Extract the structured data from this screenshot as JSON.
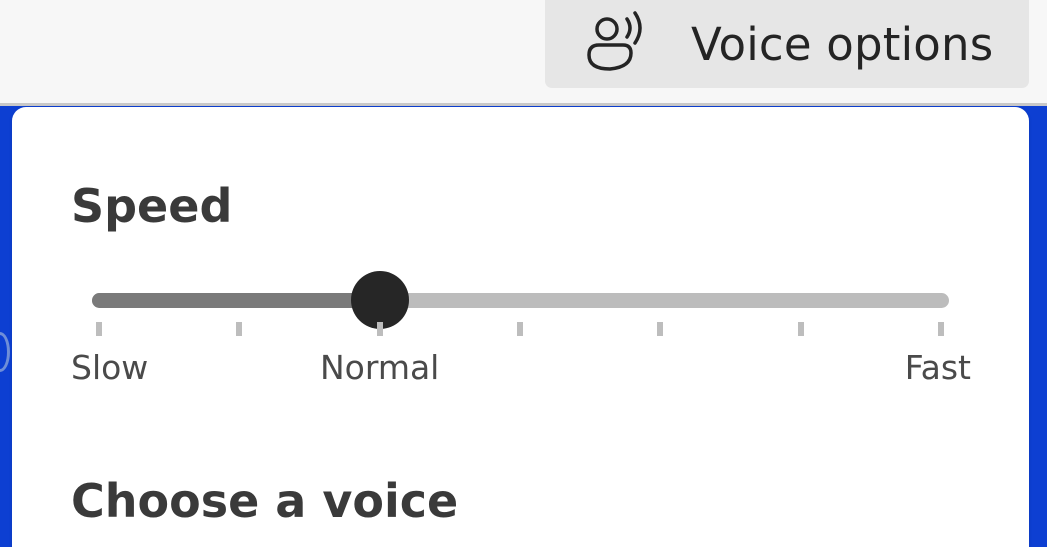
{
  "header": {
    "voice_options_label": "Voice options",
    "voice_options_icon": "person-speaking-icon"
  },
  "panel": {
    "speed_title": "Speed",
    "slider": {
      "min": 0,
      "max": 6,
      "value": 2,
      "tick_count": 7,
      "labels": [
        {
          "index": 0,
          "text": "Slow"
        },
        {
          "index": 2,
          "text": "Normal"
        },
        {
          "index": 6,
          "text": "Fast"
        }
      ]
    },
    "choose_voice_title": "Choose a voice"
  },
  "colors": {
    "accent_blue": "#0d3fd2",
    "thumb": "#262626",
    "track_fill": "#7a7a7a",
    "track": "#bcbcbc"
  }
}
